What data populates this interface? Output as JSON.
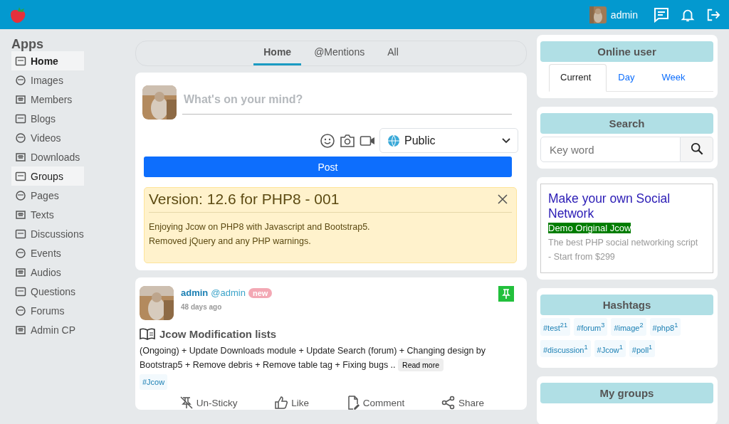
{
  "topbar": {
    "user": "admin"
  },
  "sidebar": {
    "title": "Apps",
    "items": [
      {
        "label": "Home",
        "selected": true
      },
      {
        "label": "Images",
        "selected": false
      },
      {
        "label": "Members",
        "selected": false
      },
      {
        "label": "Blogs",
        "selected": false
      },
      {
        "label": "Videos",
        "selected": false
      },
      {
        "label": "Downloads",
        "selected": false
      },
      {
        "label": "Groups",
        "selected": true
      },
      {
        "label": "Pages",
        "selected": false
      },
      {
        "label": "Texts",
        "selected": false
      },
      {
        "label": "Discussions",
        "selected": false
      },
      {
        "label": "Events",
        "selected": false
      },
      {
        "label": "Audios",
        "selected": false
      },
      {
        "label": "Questions",
        "selected": false
      },
      {
        "label": "Forums",
        "selected": false
      },
      {
        "label": "Admin CP",
        "selected": false
      }
    ]
  },
  "feed_tabs": [
    {
      "label": "Home",
      "selected": true
    },
    {
      "label": "@Mentions",
      "selected": false
    },
    {
      "label": "All",
      "selected": false
    }
  ],
  "composer": {
    "placeholder": "What's on your mind?",
    "privacy": "Public",
    "post_button": "Post"
  },
  "notice": {
    "title": "Version: 12.6 for PHP8 - 001",
    "lines": [
      "Enjoying Jcow on PHP8 with Javascript and Bootstrap5.",
      "Removed jQuery and any PHP warnings."
    ]
  },
  "post": {
    "author": "admin",
    "handle": "@admin",
    "badge": "new",
    "time": "48 days ago",
    "sticky": true,
    "title": "Jcow Modification lists",
    "body": "(Ongoing) + Update Downloads module + Update Search (forum) + Changing design by Bootstrap5 + Remove debris + Remove table tag + Fixing bugs ..",
    "read_more": "Read more",
    "tags": [
      "#Jcow"
    ],
    "actions": [
      "Un-Sticky",
      "Like",
      "Comment",
      "Share"
    ]
  },
  "online_user": {
    "title": "Online user",
    "tabs": [
      {
        "label": "Current",
        "selected": true
      },
      {
        "label": "Day",
        "selected": false
      },
      {
        "label": "Week",
        "selected": false
      }
    ]
  },
  "search": {
    "title": "Search",
    "placeholder": "Key word"
  },
  "ad": {
    "title": "Make your own Social Network",
    "link": "Demo Original Jcow",
    "text": "The best PHP social networking script - Start from $299"
  },
  "hashtags": {
    "title": "Hashtags",
    "items": [
      "#test$^{21}$",
      "#forum$^{3}$",
      "#image$^{2}$",
      "#php8$^{1}$",
      "#discussion$^{1}$",
      "#Jcow$^{1}$",
      "#poll$^{1}$"
    ]
  },
  "my_groups": {
    "title": "My groups"
  }
}
